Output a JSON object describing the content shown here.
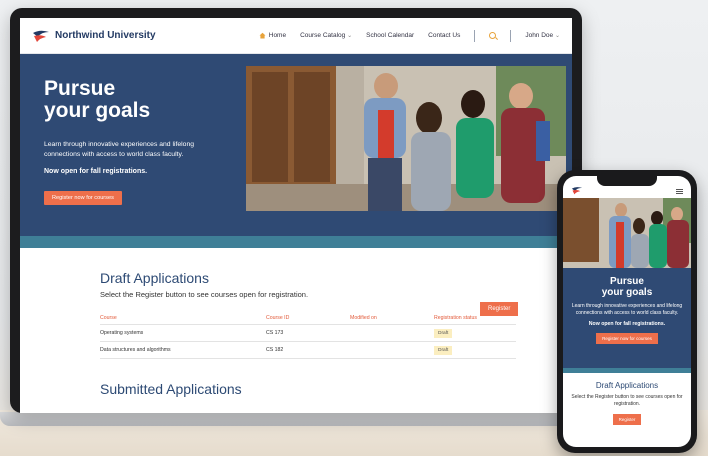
{
  "brand": {
    "name": "Northwind University"
  },
  "nav": {
    "items": [
      {
        "label": "Home"
      },
      {
        "label": "Course Catalog"
      },
      {
        "label": "School Calendar"
      },
      {
        "label": "Contact Us"
      }
    ],
    "user": "John Doe"
  },
  "hero": {
    "title_line1": "Pursue",
    "title_line2": "your goals",
    "body": "Learn through innovative experiences and lifelong connections with access to world class faculty.",
    "strong": "Now open for fall registrations.",
    "cta": "Register now for courses"
  },
  "draft": {
    "title": "Draft Applications",
    "subtitle": "Select the Register button to see courses open for registration.",
    "register_label": "Register",
    "columns": [
      "Course",
      "Course ID",
      "Modified on",
      "Registration status"
    ],
    "rows": [
      {
        "course": "Operating systems",
        "id": "CS 173",
        "modified": "",
        "status": "Draft"
      },
      {
        "course": "Data structures and algorithms",
        "id": "CS 182",
        "modified": "",
        "status": "Draft"
      }
    ]
  },
  "submitted": {
    "title": "Submitted Applications"
  },
  "mobile": {
    "title_line1": "Pursue",
    "title_line2": "your goals",
    "body": "Learn through innovative experiences and lifelong connections with access to world class faculty.",
    "strong": "Now open for fall registrations.",
    "cta": "Register now for courses",
    "draft_title": "Draft Applications",
    "draft_subtitle": "Select the Register button to see courses open for registration.",
    "register_label": "Register"
  },
  "colors": {
    "navy": "#2f4a74",
    "accent": "#ee6f4b",
    "teal": "#3f7f97",
    "draft_badge": "#fbeec0"
  }
}
